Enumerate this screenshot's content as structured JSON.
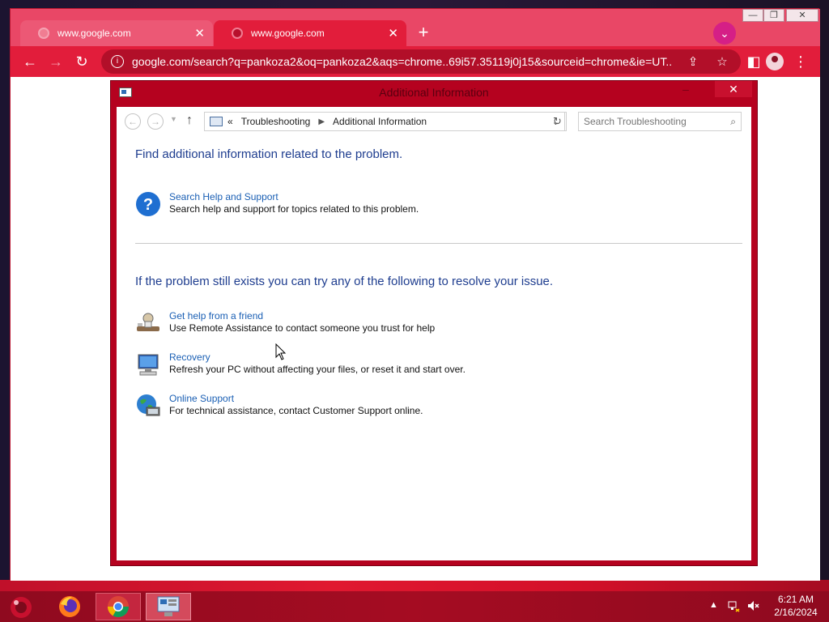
{
  "browser": {
    "tabs": [
      {
        "title": "www.google.com",
        "active": false
      },
      {
        "title": "www.google.com",
        "active": true
      }
    ],
    "new_tab": "+",
    "url": "google.com/search?q=pankoza2&oq=pankoza2&aqs=chrome..69i57.35119j0j15&sourceid=chrome&ie=UT...",
    "theme_color": "#e21d3b"
  },
  "dialog": {
    "title": "Additional Information",
    "breadcrumb": {
      "prefix": "«",
      "items": [
        "Troubleshooting",
        "Additional Information"
      ]
    },
    "search_placeholder": "Search Troubleshooting",
    "heading_1": "Find additional information related to the problem.",
    "heading_2": "If the problem still exists you can try any of the following to resolve your issue.",
    "items": [
      {
        "link": "Search Help and Support",
        "desc": "Search help and support for topics related to this problem.",
        "icon": "help-icon"
      },
      {
        "link": "Get help from a friend",
        "desc": "Use Remote Assistance to contact someone you trust for help",
        "icon": "remote-assistance-icon"
      },
      {
        "link": "Recovery",
        "desc": "Refresh your PC without affecting your files, or reset it and start over.",
        "icon": "recovery-icon"
      },
      {
        "link": "Online Support",
        "desc": "For technical assistance, contact Customer Support online.",
        "icon": "globe-icon"
      }
    ],
    "link_color": "#1a5fb4",
    "heading_color": "#1e3d8f"
  },
  "taskbar": {
    "apps": [
      "firefox-icon",
      "chrome-icon",
      "troubleshooting-icon"
    ],
    "clock": {
      "time": "6:21 AM",
      "date": "2/16/2024"
    }
  }
}
